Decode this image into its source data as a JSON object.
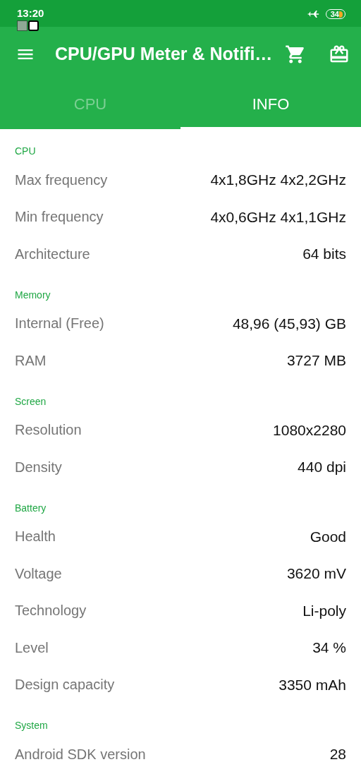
{
  "status_bar": {
    "time": "13:20",
    "battery": "34"
  },
  "app_bar": {
    "title": "CPU/GPU Meter & Notifi…"
  },
  "tabs": [
    {
      "label": "CPU",
      "selected": false
    },
    {
      "label": "INFO",
      "selected": true
    }
  ],
  "sections": [
    {
      "title": "CPU",
      "rows": [
        {
          "label": "Max frequency",
          "value": "4x1,8GHz 4x2,2GHz"
        },
        {
          "label": "Min frequency",
          "value": "4x0,6GHz 4x1,1GHz"
        },
        {
          "label": "Architecture",
          "value": "64 bits"
        }
      ]
    },
    {
      "title": "Memory",
      "rows": [
        {
          "label": "Internal (Free)",
          "value": "48,96 (45,93) GB"
        },
        {
          "label": "RAM",
          "value": "3727 MB"
        }
      ]
    },
    {
      "title": "Screen",
      "rows": [
        {
          "label": "Resolution",
          "value": "1080x2280"
        },
        {
          "label": "Density",
          "value": "440 dpi"
        }
      ]
    },
    {
      "title": "Battery",
      "rows": [
        {
          "label": "Health",
          "value": "Good"
        },
        {
          "label": "Voltage",
          "value": "3620 mV"
        },
        {
          "label": "Technology",
          "value": "Li-poly"
        },
        {
          "label": "Level",
          "value": "34 %"
        },
        {
          "label": "Design capacity",
          "value": "3350 mAh"
        }
      ]
    },
    {
      "title": "System",
      "rows": [
        {
          "label": "Android SDK version",
          "value": "28"
        }
      ]
    }
  ]
}
